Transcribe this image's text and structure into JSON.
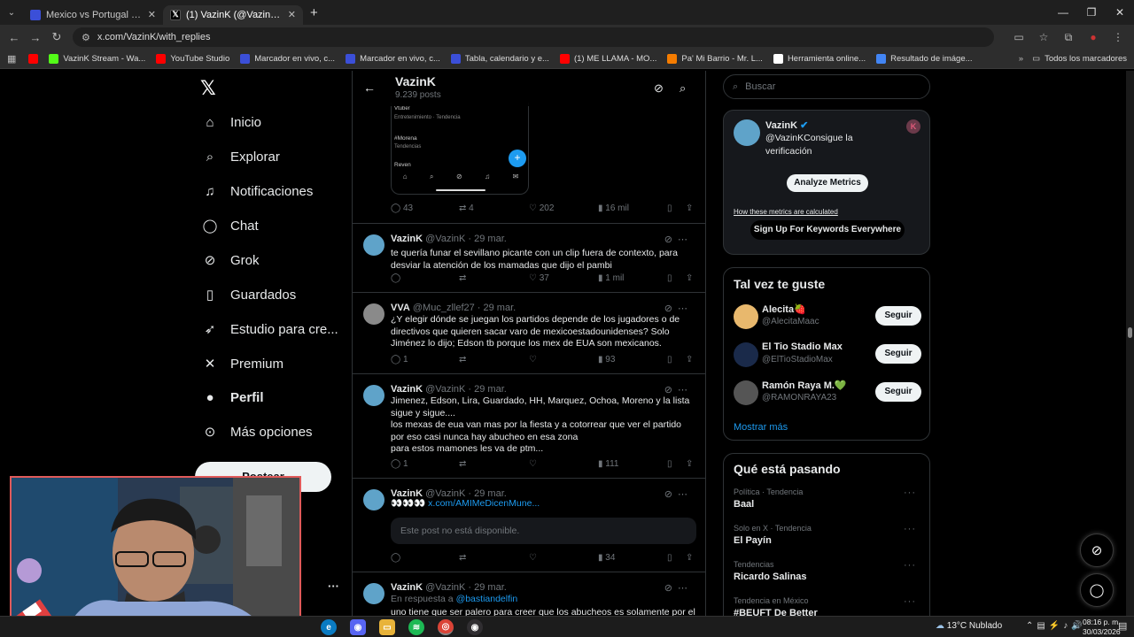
{
  "browser": {
    "tabs": [
      {
        "title": "Mexico vs Portugal resultados e",
        "close": "✕",
        "active": false,
        "fav_color": "#3b4fd8"
      },
      {
        "title": "(1) VazinK (@VazinK) / X",
        "close": "✕",
        "active": true,
        "fav_color": "#000000"
      }
    ],
    "new_tab": "+",
    "url": "x.com/VazinK/with_replies",
    "bookmarks": [
      {
        "label": "",
        "color": "#ff0000"
      },
      {
        "label": "VazinK Stream - Wa...",
        "color": "#53fc18"
      },
      {
        "label": "YouTube Studio",
        "color": "#ff0000"
      },
      {
        "label": "Marcador en vivo, c...",
        "color": "#3b4fd8"
      },
      {
        "label": "Marcador en vivo, c...",
        "color": "#3b4fd8"
      },
      {
        "label": "Tabla, calendario y e...",
        "color": "#3b4fd8"
      },
      {
        "label": "(1) ME LLAMA - MO...",
        "color": "#ff0000"
      },
      {
        "label": "Pa' Mi Barrio - Mr. L...",
        "color": "#f57c00"
      },
      {
        "label": "Herramienta online...",
        "color": "#ffffff"
      },
      {
        "label": "Resultado de imáge...",
        "color": "#4285f4"
      }
    ],
    "all_bookmarks": "Todos los marcadores"
  },
  "sidebar": {
    "logo": "𝕏",
    "items": [
      {
        "label": "Inicio",
        "icon": "home-icon",
        "glyph": "⌂"
      },
      {
        "label": "Explorar",
        "icon": "search-icon",
        "glyph": "⌕"
      },
      {
        "label": "Notificaciones",
        "icon": "bell-icon",
        "glyph": "♫"
      },
      {
        "label": "Chat",
        "icon": "chat-icon",
        "glyph": "◯"
      },
      {
        "label": "Grok",
        "icon": "grok-icon",
        "glyph": "⊘"
      },
      {
        "label": "Guardados",
        "icon": "bookmark-icon",
        "glyph": "▯"
      },
      {
        "label": "Estudio para cre...",
        "icon": "rocket-icon",
        "glyph": "➶"
      },
      {
        "label": "Premium",
        "icon": "x-premium-icon",
        "glyph": "✕"
      },
      {
        "label": "Perfil",
        "icon": "person-icon",
        "glyph": "●"
      },
      {
        "label": "Más opciones",
        "icon": "more-circle-icon",
        "glyph": "⊙"
      }
    ],
    "post_button": "Postear",
    "account_more": "···"
  },
  "profile_header": {
    "name": "VazinK",
    "post_count": "9.239 posts"
  },
  "embedded_phone": {
    "lines": [
      "Vtuber",
      "Entretenimiento · Tendencia",
      "#Morena",
      "Tendencias",
      "Reven"
    ]
  },
  "first_actions": {
    "replies": "43",
    "reposts": "4",
    "likes": "202",
    "views": "16 mil"
  },
  "tweets": [
    {
      "name": "VazinK",
      "handle": "@VazinK · 29 mar.",
      "text": "te quería funar el sevillano picante con un clip fuera de contexto, para desviar la atención de los mamadas que dijo el pambi",
      "replies": "",
      "reposts": "",
      "likes": "37",
      "views": "1 mil",
      "avatar_color": "#5fa3c9"
    },
    {
      "name": "VVA",
      "handle": "@Muc_zllef27 · 29 mar.",
      "text": "¿Y elegir dónde se juegan los partidos depende de los jugadores o de directivos que quieren sacar varo de mexicoestadounidenses? Solo Jiménez lo dijo; Edson tb porque los mex de EUA son mexicanos.",
      "replies": "1",
      "reposts": "",
      "likes": "",
      "views": "93",
      "avatar_color": "#8a8a8a"
    },
    {
      "name": "VazinK",
      "handle": "@VazinK · 29 mar.",
      "text_lines": [
        "Jimenez, Edson, Lira, Guardado, HH, Marquez, Ochoa, Moreno y la lista sigue y sigue....",
        "los mexas de eua van mas por la fiesta y a cotorrear que ver el partido por eso casi nunca hay abucheo en esa zona",
        "para estos mamones les va de ptm..."
      ],
      "replies": "1",
      "reposts": "",
      "likes": "",
      "views": "111",
      "avatar_color": "#5fa3c9"
    },
    {
      "name": "VazinK",
      "handle": "@VazinK · 29 mar.",
      "emoji": "👀👀👀",
      "link": "x.com/AMIMeDicenMune...",
      "unavailable": "Este post no está disponible.",
      "replies": "",
      "reposts": "",
      "likes": "",
      "views": "34",
      "avatar_color": "#5fa3c9"
    },
    {
      "name": "VazinK",
      "handle": "@VazinK · 29 mar.",
      "reply_prefix": "En respuesta a",
      "reply_to": "@bastiandelfin",
      "text": "uno tiene que ser palero para creer que los abucheos es solamente por el",
      "avatar_color": "#5fa3c9"
    }
  ],
  "right": {
    "search_placeholder": "Buscar",
    "metrics_card": {
      "name": "VazinK",
      "handle_line1": "@VazinKConsigue la",
      "handle_line2": "verificación",
      "analyze": "Analyze Metrics",
      "how": "How these metrics are calculated",
      "signup": "Sign Up For Keywords Everywhere",
      "badge": "K"
    },
    "suggest_title": "Tal vez te guste",
    "suggestions": [
      {
        "name": "Alecita🍓",
        "handle": "@AlecitaMaac",
        "follow": "Seguir",
        "color": "#e8b86d"
      },
      {
        "name": "El Tio Stadio Max",
        "handle": "@ElTioStadioMax",
        "follow": "Seguir",
        "color": "#1a2a4a"
      },
      {
        "name": "Ramón Raya M.💚",
        "handle": "@RAMONRAYA23",
        "follow": "Seguir",
        "color": "#555555"
      }
    ],
    "show_more": "Mostrar más",
    "trends_title": "Qué está pasando",
    "trends": [
      {
        "context": "Política · Tendencia",
        "name": "Baal"
      },
      {
        "context": "Solo en X · Tendencia",
        "name": "El Payín"
      },
      {
        "context": "Tendencias",
        "name": "Ricardo Salinas"
      },
      {
        "context": "Tendencia en México",
        "name": "#BEUFT De Better"
      }
    ],
    "trend_more": "···"
  },
  "taskbar": {
    "weather": "13°C  Nublado",
    "time": "08:16 p. m.",
    "date": "30/03/2026"
  }
}
